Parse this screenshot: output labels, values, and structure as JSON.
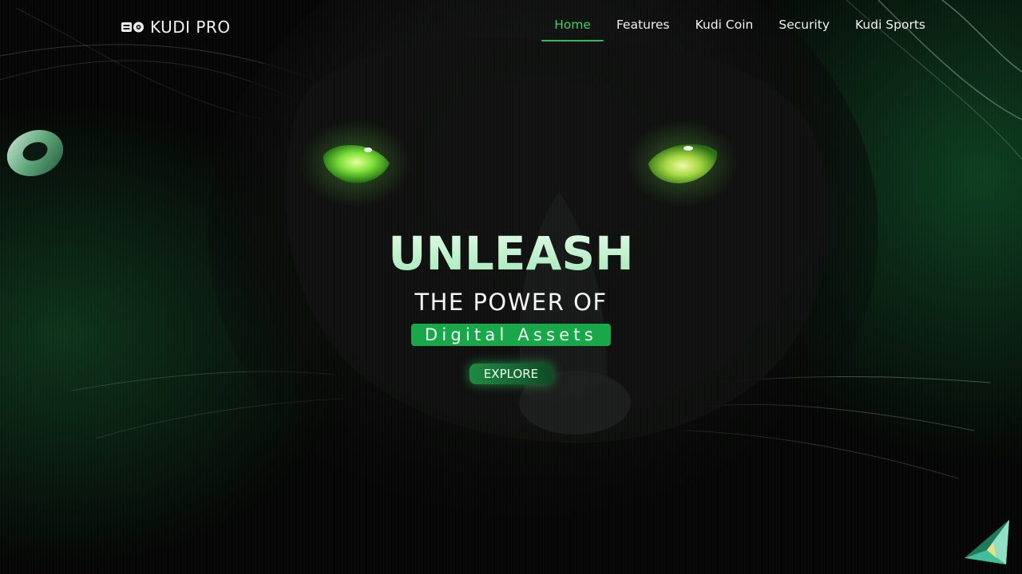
{
  "brand": {
    "logo_text": "KUDI PRO",
    "logo_icon": "kudi-logo-icon"
  },
  "nav": {
    "items": [
      {
        "label": "Home",
        "active": true
      },
      {
        "label": "Features",
        "active": false
      },
      {
        "label": "Kudi Coin",
        "active": false
      },
      {
        "label": "Security",
        "active": false
      },
      {
        "label": "Kudi Sports",
        "active": false
      }
    ]
  },
  "hero": {
    "title": "UNLEASH",
    "subtitle": "THE POWER OF",
    "tag": "Digital Assets",
    "cta_label": "EXPLORE"
  },
  "colors": {
    "accent": "#2fbf5a",
    "tag_background": "#18a84a",
    "eye_green": "#6fe03a",
    "background": "#020302"
  },
  "decorations": {
    "left": "torus-ring-icon",
    "bottom_right": "pyramid-icon",
    "background": "black-panther-face"
  }
}
